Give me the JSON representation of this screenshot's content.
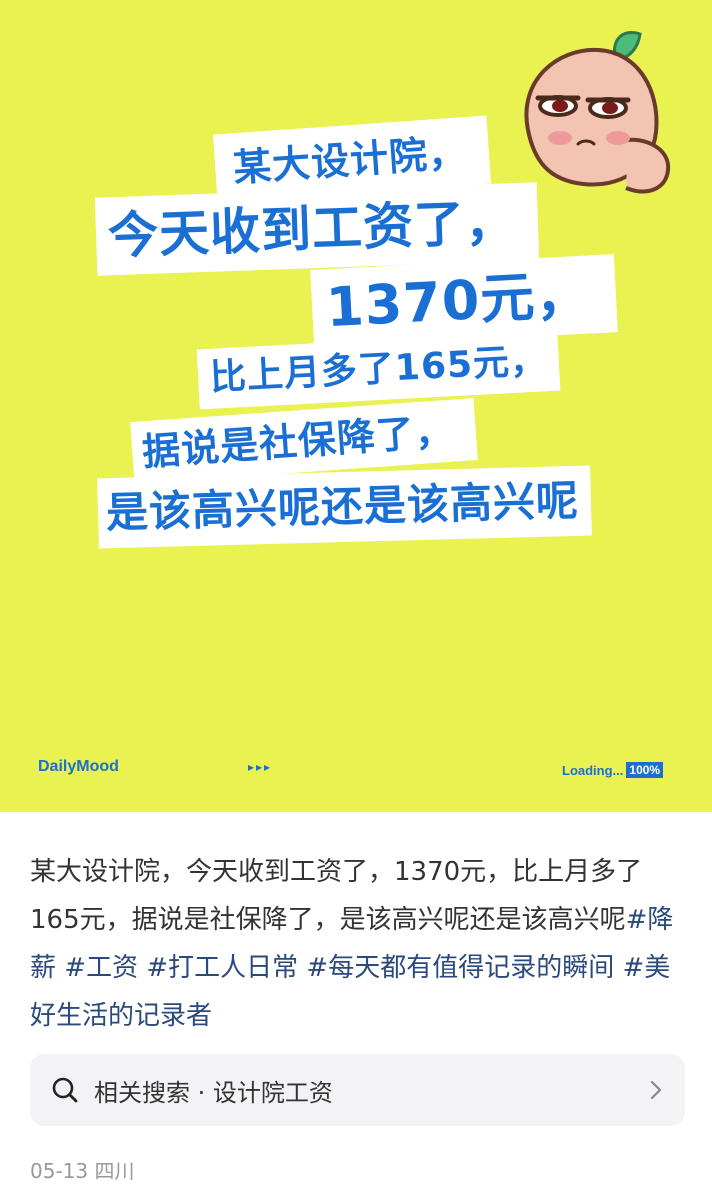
{
  "poster": {
    "lines": [
      "某大设计院，",
      "今天收到工资了，",
      "1370元，",
      "比上月多了165元，",
      "据说是社保降了，",
      "是该高兴呢还是该高兴呢"
    ],
    "brand": "DailyMood",
    "dots": "▸▸▸",
    "loading_label": "Loading...",
    "loading_percent": "100%",
    "sticker_icon": "peach-sticker-icon",
    "colors": {
      "background": "#e9f251",
      "accent": "#1a6fd4",
      "strip": "#ffffff"
    }
  },
  "post": {
    "text": "某大设计院，今天收到工资了，1370元，比上月多了165元，据说是社保降了，是该高兴呢还是该高兴呢",
    "tags": [
      "#降薪",
      "#工资",
      "#打工人日常",
      "#每天都有值得记录的瞬间",
      "#美好生活的记录者"
    ],
    "tag_color": "#2b4a7c"
  },
  "related_search": {
    "icon": "search-icon",
    "label": "相关搜索 · 设计院工资",
    "chevron": "chevron-right-icon"
  },
  "meta": {
    "date_location": "05-13 四川"
  }
}
